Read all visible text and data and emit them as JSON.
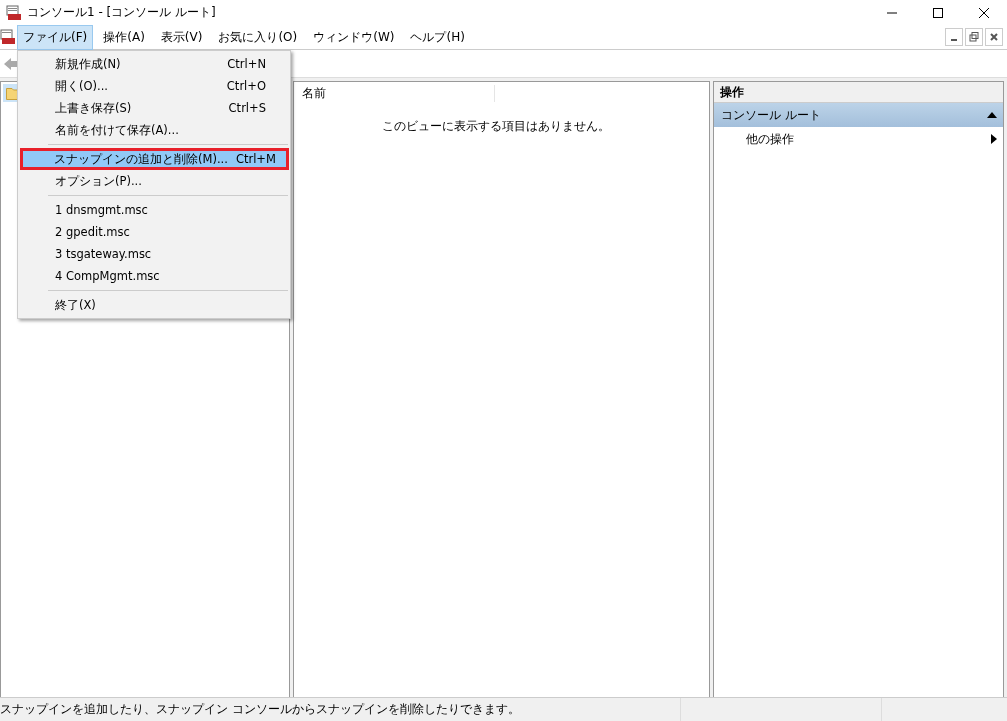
{
  "window": {
    "title": "コンソール1 - [コンソール ルート]"
  },
  "menubar": [
    {
      "label": "ファイル(F)",
      "selected": true
    },
    {
      "label": "操作(A)",
      "selected": false
    },
    {
      "label": "表示(V)",
      "selected": false
    },
    {
      "label": "お気に入り(O)",
      "selected": false
    },
    {
      "label": "ウィンドウ(W)",
      "selected": false
    },
    {
      "label": "ヘルプ(H)",
      "selected": false
    }
  ],
  "file_menu": [
    {
      "kind": "item",
      "label": "新規作成(N)",
      "shortcut": "Ctrl+N",
      "selected": false,
      "annotated": false
    },
    {
      "kind": "item",
      "label": "開く(O)...",
      "shortcut": "Ctrl+O",
      "selected": false,
      "annotated": false
    },
    {
      "kind": "item",
      "label": "上書き保存(S)",
      "shortcut": "Ctrl+S",
      "selected": false,
      "annotated": false
    },
    {
      "kind": "item",
      "label": "名前を付けて保存(A)...",
      "selected": false,
      "annotated": false
    },
    {
      "kind": "separator"
    },
    {
      "kind": "item",
      "label": "スナップインの追加と削除(M)...",
      "shortcut": "Ctrl+M",
      "selected": true,
      "annotated": true
    },
    {
      "kind": "item",
      "label": "オプション(P)...",
      "selected": false,
      "annotated": false
    },
    {
      "kind": "separator"
    },
    {
      "kind": "item",
      "label": "1 dnsmgmt.msc",
      "selected": false,
      "annotated": false
    },
    {
      "kind": "item",
      "label": "2 gpedit.msc",
      "selected": false,
      "annotated": false
    },
    {
      "kind": "item",
      "label": "3 tsgateway.msc",
      "selected": false,
      "annotated": false
    },
    {
      "kind": "item",
      "label": "4 CompMgmt.msc",
      "selected": false,
      "annotated": false
    },
    {
      "kind": "separator"
    },
    {
      "kind": "item",
      "label": "終了(X)",
      "selected": false,
      "annotated": false
    }
  ],
  "tree": {
    "items": [
      {
        "selected": true
      }
    ]
  },
  "list": {
    "columns": [
      "名前"
    ],
    "empty_message": "このビューに表示する項目はありません。"
  },
  "actions": {
    "header": "操作",
    "section": "コンソール ルート",
    "items": [
      "他の操作"
    ]
  },
  "status_bar": "スナップインを追加したり、スナップイン コンソールからスナップインを削除したりできます。"
}
